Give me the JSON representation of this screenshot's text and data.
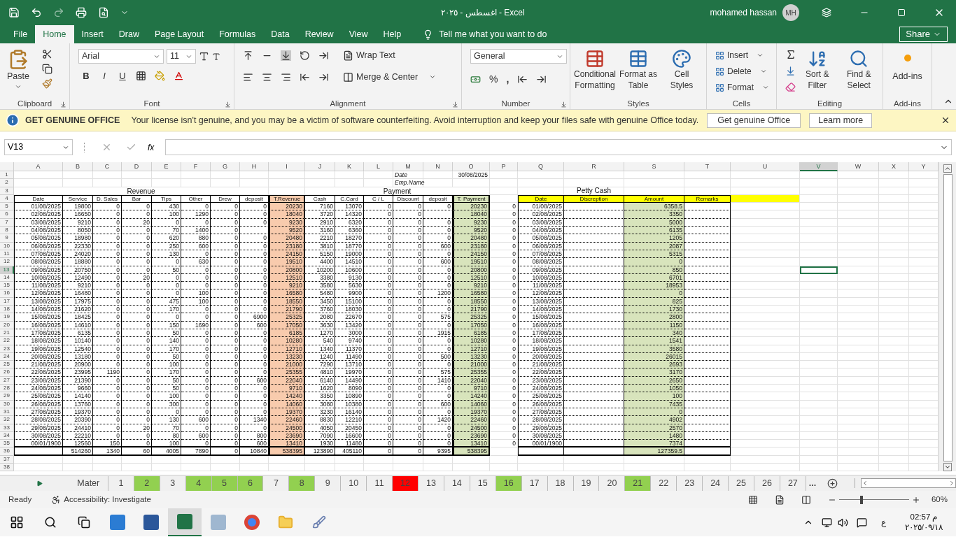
{
  "title_bar": {
    "title": "اغسطس - ٢٠٢٥ - Excel",
    "user": "mohamed hassan",
    "initials": "MH"
  },
  "menu_tabs": [
    {
      "label": "File",
      "selected": false
    },
    {
      "label": "Home",
      "selected": true
    },
    {
      "label": "Insert",
      "selected": false
    },
    {
      "label": "Draw",
      "selected": false
    },
    {
      "label": "Page Layout",
      "selected": false
    },
    {
      "label": "Formulas",
      "selected": false
    },
    {
      "label": "Data",
      "selected": false
    },
    {
      "label": "Review",
      "selected": false
    },
    {
      "label": "View",
      "selected": false
    },
    {
      "label": "Help",
      "selected": false
    }
  ],
  "tell_me": "Tell me what you want to do",
  "share": "Share",
  "ribbon": {
    "paste": "Paste",
    "font_name": "Arial",
    "font_size": "11",
    "format_buttons": [
      "B",
      "I",
      "U"
    ],
    "wrap_text": "Wrap Text",
    "merge": "Merge & Center",
    "number_format": "General",
    "percent": "%",
    "comma": ",",
    "styles": [
      {
        "lines": [
          "Conditional",
          "Formatting"
        ]
      },
      {
        "lines": [
          "Format as",
          "Table"
        ]
      },
      {
        "lines": [
          "Cell",
          "Styles"
        ]
      }
    ],
    "cells": [
      "Insert",
      "Delete",
      "Format"
    ],
    "editing": [
      {
        "lines": [
          "Sort &",
          "Filter"
        ]
      },
      {
        "lines": [
          "Find &",
          "Select"
        ]
      }
    ],
    "addins": "Add-ins",
    "groups": [
      "Clipboard",
      "Font",
      "Alignment",
      "Number",
      "Styles",
      "Cells",
      "Editing",
      "Add-ins"
    ]
  },
  "message_bar": {
    "title": "GET GENUINE OFFICE",
    "text": "Your license isn't genuine, and you may be a victim of software counterfeiting. Avoid interruption and keep your files safe with genuine Office today.",
    "buttons": [
      "Get genuine Office",
      "Learn more"
    ]
  },
  "formula_bar": {
    "name_box": "V13",
    "fx": "fx"
  },
  "sheet": {
    "columns": [
      {
        "letter": "A",
        "selected": false
      },
      {
        "letter": "B",
        "selected": false
      },
      {
        "letter": "C",
        "selected": false
      },
      {
        "letter": "D",
        "selected": false
      },
      {
        "letter": "E",
        "selected": false
      },
      {
        "letter": "F",
        "selected": false
      },
      {
        "letter": "G",
        "selected": false
      },
      {
        "letter": "H",
        "selected": false
      },
      {
        "letter": "I",
        "selected": false
      },
      {
        "letter": "J",
        "selected": false
      },
      {
        "letter": "K",
        "selected": false
      },
      {
        "letter": "L",
        "selected": false
      },
      {
        "letter": "M",
        "selected": false
      },
      {
        "letter": "N",
        "selected": false
      },
      {
        "letter": "O",
        "selected": false
      },
      {
        "letter": "P",
        "selected": false
      },
      {
        "letter": "Q",
        "selected": false
      },
      {
        "letter": "R",
        "selected": false
      },
      {
        "letter": "S",
        "selected": false
      },
      {
        "letter": "T",
        "selected": false
      },
      {
        "letter": "U",
        "selected": false
      },
      {
        "letter": "V",
        "selected": true
      },
      {
        "letter": "W",
        "selected": false
      },
      {
        "letter": "X",
        "selected": false
      },
      {
        "letter": "Y",
        "selected": false
      }
    ],
    "row_numbers": [
      {
        "label": "1",
        "selected": false
      },
      {
        "label": "2",
        "selected": false
      },
      {
        "label": "3",
        "selected": false
      },
      {
        "label": "4",
        "selected": false
      },
      {
        "label": "5",
        "selected": false
      },
      {
        "label": "6",
        "selected": false
      },
      {
        "label": "7",
        "selected": false
      },
      {
        "label": "8",
        "selected": false
      },
      {
        "label": "9",
        "selected": false
      },
      {
        "label": "10",
        "selected": false
      },
      {
        "label": "11",
        "selected": false
      },
      {
        "label": "12",
        "selected": false
      },
      {
        "label": "13",
        "selected": true
      },
      {
        "label": "14",
        "selected": false
      },
      {
        "label": "15",
        "selected": false
      },
      {
        "label": "16",
        "selected": false
      },
      {
        "label": "17",
        "selected": false
      },
      {
        "label": "18",
        "selected": false
      },
      {
        "label": "19",
        "selected": false
      },
      {
        "label": "20",
        "selected": false
      },
      {
        "label": "21",
        "selected": false
      },
      {
        "label": "22",
        "selected": false
      },
      {
        "label": "23",
        "selected": false
      },
      {
        "label": "24",
        "selected": false
      },
      {
        "label": "25",
        "selected": false
      },
      {
        "label": "26",
        "selected": false
      },
      {
        "label": "27",
        "selected": false
      },
      {
        "label": "28",
        "selected": false
      },
      {
        "label": "29",
        "selected": false
      },
      {
        "label": "30",
        "selected": false
      },
      {
        "label": "31",
        "selected": false
      },
      {
        "label": "32",
        "selected": false
      },
      {
        "label": "33",
        "selected": false
      },
      {
        "label": "34",
        "selected": false
      },
      {
        "label": "35",
        "selected": false
      },
      {
        "label": "36",
        "selected": false
      },
      {
        "label": "37",
        "selected": false
      },
      {
        "label": "38",
        "selected": false
      }
    ],
    "info": {
      "date_label": "Date",
      "date_value": "30/08/2025",
      "emp_label": "Emp.Name"
    },
    "revenue_title": "Revenue",
    "payment_title": "Payment",
    "petty_title": "Petty Cash",
    "main_headers": [
      "Date",
      "Service",
      "D. Sales",
      "Bar",
      "Tips",
      "Other",
      "Drew",
      "deposit",
      "T.Revenue",
      "Cash",
      "C.Card",
      "C / L",
      "Discount",
      "deposit",
      "T. Payment"
    ],
    "main_rows": [
      [
        "01/08/2025",
        "19800",
        "0",
        "0",
        "430",
        "0",
        "0",
        "0",
        "20230",
        "7160",
        "13070",
        "0",
        "0",
        "0",
        "20230"
      ],
      [
        "02/08/2025",
        "16650",
        "0",
        "0",
        "100",
        "1290",
        "0",
        "0",
        "18040",
        "3720",
        "14320",
        "0",
        "0",
        null,
        "18040"
      ],
      [
        "03/08/2025",
        "9210",
        "0",
        "20",
        "0",
        "0",
        "0",
        "0",
        "9230",
        "2910",
        "6320",
        "0",
        "0",
        "0",
        "9230"
      ],
      [
        "04/08/2025",
        "8050",
        "0",
        "0",
        "70",
        "1400",
        "0",
        null,
        "9520",
        "3160",
        "6360",
        "0",
        "0",
        "0",
        "9520"
      ],
      [
        "05/08/2025",
        "18980",
        "0",
        "0",
        "620",
        "880",
        "0",
        "0",
        "20480",
        "2210",
        "18270",
        "0",
        "0",
        "0",
        "20480"
      ],
      [
        "06/08/2025",
        "22330",
        "0",
        "0",
        "250",
        "600",
        "0",
        "0",
        "23180",
        "3810",
        "18770",
        "0",
        "0",
        "600",
        "23180"
      ],
      [
        "07/08/2025",
        "24020",
        "0",
        "0",
        "130",
        "0",
        "0",
        "0",
        "24150",
        "5150",
        "19000",
        "0",
        "0",
        "0",
        "24150"
      ],
      [
        "08/08/2025",
        "18880",
        "0",
        "0",
        "0",
        "630",
        "0",
        "0",
        "19510",
        "4400",
        "14510",
        "0",
        "0",
        "600",
        "19510"
      ],
      [
        "09/08/2025",
        "20750",
        "0",
        "0",
        "50",
        "0",
        "0",
        "0",
        "20800",
        "10200",
        "10600",
        "0",
        "0",
        "0",
        "20800"
      ],
      [
        "10/08/2025",
        "12490",
        "0",
        "20",
        "0",
        "0",
        "0",
        "0",
        "12510",
        "3380",
        "9130",
        "0",
        "0",
        "0",
        "12510"
      ],
      [
        "11/08/2025",
        "9210",
        "0",
        "0",
        "0",
        "0",
        "0",
        "0",
        "9210",
        "3580",
        "5630",
        "0",
        "0",
        "0",
        "9210"
      ],
      [
        "12/08/2025",
        "16480",
        "0",
        "0",
        "0",
        "100",
        "0",
        "0",
        "16580",
        "5480",
        "9900",
        "0",
        "0",
        "1200",
        "16580"
      ],
      [
        "13/08/2025",
        "17975",
        "0",
        "0",
        "475",
        "100",
        "0",
        "0",
        "18550",
        "3450",
        "15100",
        "0",
        "0",
        "0",
        "18550"
      ],
      [
        "14/08/2025",
        "21620",
        "0",
        "0",
        "170",
        "0",
        "0",
        "0",
        "21790",
        "3760",
        "18030",
        "0",
        "0",
        "0",
        "21790"
      ],
      [
        "15/08/2025",
        "18425",
        "0",
        "0",
        "0",
        "0",
        "0",
        "6900",
        "25325",
        "2080",
        "22670",
        "0",
        "0",
        "575",
        "25325"
      ],
      [
        "16/08/2025",
        "14610",
        "0",
        "0",
        "150",
        "1690",
        "0",
        "600",
        "17050",
        "3630",
        "13420",
        "0",
        "0",
        "0",
        "17050"
      ],
      [
        "17/08/2025",
        "6135",
        "0",
        "0",
        "50",
        "0",
        "0",
        "0",
        "6185",
        "1270",
        "3000",
        "0",
        "0",
        "1915",
        "6185"
      ],
      [
        "18/08/2025",
        "10140",
        "0",
        "0",
        "140",
        "0",
        "0",
        "0",
        "10280",
        "540",
        "9740",
        "0",
        "0",
        "0",
        "10280"
      ],
      [
        "19/08/2025",
        "12540",
        "0",
        "0",
        "170",
        "0",
        "0",
        "0",
        "12710",
        "1340",
        "11370",
        "0",
        "0",
        "0",
        "12710"
      ],
      [
        "20/08/2025",
        "13180",
        "0",
        "0",
        "50",
        "0",
        "0",
        "0",
        "13230",
        "1240",
        "11490",
        "0",
        "0",
        "500",
        "13230"
      ],
      [
        "21/08/2025",
        "20900",
        "0",
        "0",
        "100",
        "0",
        "0",
        "0",
        "21000",
        "7290",
        "13710",
        "0",
        "0",
        "0",
        "21000"
      ],
      [
        "22/08/2025",
        "23995",
        "1190",
        "0",
        "170",
        "0",
        "0",
        "0",
        "25355",
        "4810",
        "19970",
        "0",
        "0",
        "575",
        "25355"
      ],
      [
        "23/08/2025",
        "21390",
        "0",
        "0",
        "50",
        "0",
        "0",
        "600",
        "22040",
        "6140",
        "14490",
        "0",
        "0",
        "1410",
        "22040"
      ],
      [
        "24/08/2025",
        "9660",
        "0",
        "0",
        "50",
        "0",
        "0",
        "0",
        "9710",
        "1620",
        "8090",
        "0",
        "0",
        "0",
        "9710"
      ],
      [
        "25/08/2025",
        "14140",
        "0",
        "0",
        "100",
        "0",
        "0",
        "0",
        "14240",
        "3350",
        "10890",
        "0",
        "0",
        "0",
        "14240"
      ],
      [
        "26/08/2025",
        "13760",
        "0",
        "0",
        "300",
        "0",
        "0",
        "0",
        "14060",
        "3080",
        "10380",
        "0",
        "0",
        "600",
        "14060"
      ],
      [
        "27/08/2025",
        "19370",
        "0",
        "0",
        "0",
        "0",
        "0",
        "0",
        "19370",
        "3230",
        "16140",
        "0",
        "0",
        "0",
        "19370"
      ],
      [
        "28/08/2025",
        "20390",
        "0",
        "0",
        "130",
        "600",
        "0",
        "1340",
        "22460",
        "8830",
        "12210",
        "0",
        "0",
        "1420",
        "22460"
      ],
      [
        "29/08/2025",
        "24410",
        "0",
        "20",
        "70",
        "0",
        "0",
        "0",
        "24500",
        "4050",
        "20450",
        "0",
        "0",
        "0",
        "24500"
      ],
      [
        "30/08/2025",
        "22210",
        "0",
        "0",
        "80",
        "600",
        "0",
        "800",
        "23690",
        "7090",
        "16600",
        "0",
        "0",
        "0",
        "23690"
      ],
      [
        "00/01/1900",
        "12560",
        "150",
        "0",
        "100",
        "0",
        "0",
        "600",
        "13410",
        "1930",
        "11480",
        "0",
        "0",
        "0",
        "13410"
      ]
    ],
    "main_totals": [
      "514260",
      "1340",
      "60",
      "4005",
      "7890",
      "0",
      "10840",
      "538395",
      "123890",
      "405110",
      "0",
      "0",
      "9395",
      "538395"
    ],
    "balance_column": [
      "0",
      "0",
      "0",
      "0",
      "0",
      "0",
      "0",
      "0",
      "0",
      "0",
      "0",
      "0",
      "0",
      "0",
      "0",
      "0",
      "0",
      "0",
      "0",
      "0",
      "0",
      "0",
      "0",
      "0",
      "0",
      "0",
      "0",
      "0",
      "0",
      "0",
      "0"
    ],
    "petty_headers": [
      "Date",
      "Discreption",
      "Amount",
      "Remarks"
    ],
    "petty_rows": [
      [
        "01/08/2025",
        "6358.5"
      ],
      [
        "02/08/2025",
        "3350"
      ],
      [
        "03/08/2025",
        "5000"
      ],
      [
        "04/08/2025",
        "6135"
      ],
      [
        "05/08/2025",
        "1205"
      ],
      [
        "06/08/2025",
        "2087"
      ],
      [
        "07/08/2025",
        "5315"
      ],
      [
        "08/08/2025",
        "0"
      ],
      [
        "09/08/2025",
        "850"
      ],
      [
        "10/08/2025",
        "6701"
      ],
      [
        "11/08/2025",
        "18953"
      ],
      [
        "12/08/2025",
        "0"
      ],
      [
        "13/08/2025",
        "825"
      ],
      [
        "14/08/2025",
        "1730"
      ],
      [
        "15/08/2025",
        "2800"
      ],
      [
        "16/08/2025",
        "1150"
      ],
      [
        "17/08/2025",
        "340"
      ],
      [
        "18/08/2025",
        "1541"
      ],
      [
        "19/08/2025",
        "3580"
      ],
      [
        "20/08/2025",
        "26015"
      ],
      [
        "21/08/2025",
        "2693"
      ],
      [
        "22/08/2025",
        "3170"
      ],
      [
        "23/08/2025",
        "2650"
      ],
      [
        "24/08/2025",
        "1050"
      ],
      [
        "25/08/2025",
        "100"
      ],
      [
        "26/08/2025",
        "7435"
      ],
      [
        "27/08/2025",
        "0"
      ],
      [
        "28/08/2025",
        "4902"
      ],
      [
        "29/08/2025",
        "2570"
      ],
      [
        "30/08/2025",
        "1480"
      ],
      [
        "00/01/1900",
        "7374"
      ]
    ],
    "petty_total": "127359.5"
  },
  "sheet_tabs": [
    {
      "label": "Mater",
      "selected": false
    },
    {
      "label": "1",
      "selected": false
    },
    {
      "label": "2",
      "selected": false,
      "color": "#92d050"
    },
    {
      "label": "3",
      "selected": false
    },
    {
      "label": "4",
      "selected": false,
      "color": "#92d050"
    },
    {
      "label": "5",
      "selected": false,
      "color": "#92d050"
    },
    {
      "label": "6",
      "selected": false,
      "color": "#92d050"
    },
    {
      "label": "7",
      "selected": false
    },
    {
      "label": "8",
      "selected": false,
      "color": "#92d050"
    },
    {
      "label": "9",
      "selected": false
    },
    {
      "label": "10",
      "selected": false
    },
    {
      "label": "11",
      "selected": false
    },
    {
      "label": "12",
      "selected": false,
      "color": "#ff0000"
    },
    {
      "label": "13",
      "selected": false
    },
    {
      "label": "14",
      "selected": false
    },
    {
      "label": "15",
      "selected": false
    },
    {
      "label": "16",
      "selected": false,
      "color": "#92d050"
    },
    {
      "label": "17",
      "selected": false
    },
    {
      "label": "18",
      "selected": false
    },
    {
      "label": "19",
      "selected": false
    },
    {
      "label": "20",
      "selected": false
    },
    {
      "label": "21",
      "selected": false,
      "color": "#92d050"
    },
    {
      "label": "22",
      "selected": false
    },
    {
      "label": "23",
      "selected": false
    },
    {
      "label": "24",
      "selected": false
    },
    {
      "label": "25",
      "selected": false
    },
    {
      "label": "26",
      "selected": false
    },
    {
      "label": "27",
      "selected": false
    }
  ],
  "more_tabs": "...",
  "status_bar": {
    "ready": "Ready",
    "accessibility": "Accessibility: Investigate",
    "zoom": "60%",
    "zoom_slider": {
      "level": 0.3
    }
  },
  "taskbar": {
    "language": "ع",
    "time": "02:57 م",
    "date": "٢٠٢٥/٠٩/١٨"
  }
}
